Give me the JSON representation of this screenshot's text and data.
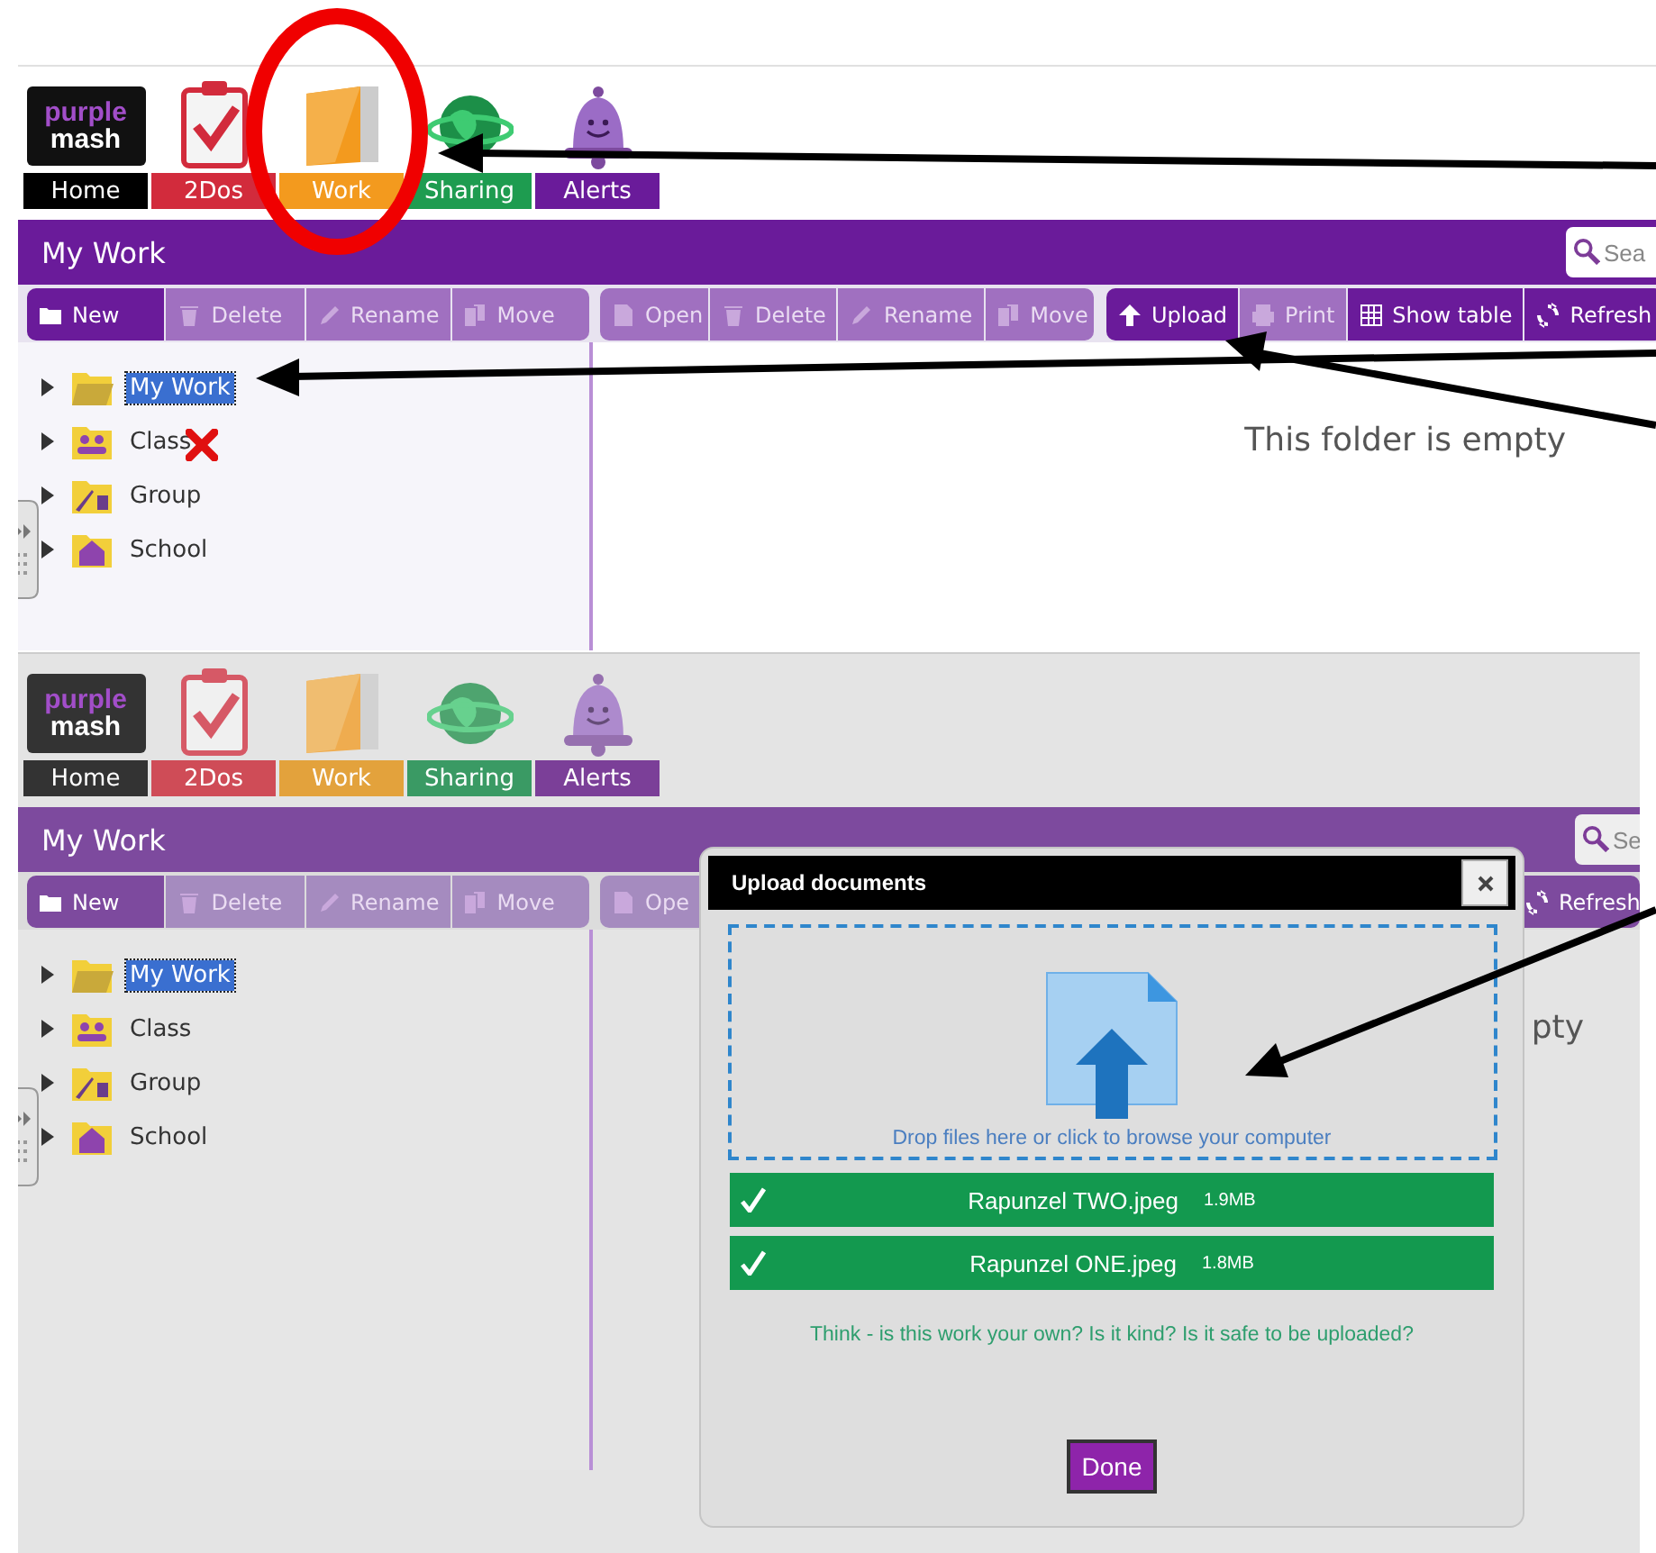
{
  "screens": [
    {
      "logo": [
        "purple",
        "mash"
      ],
      "nav": [
        {
          "label": "Home",
          "kind": "home",
          "color": "#000000"
        },
        {
          "label": "2Dos",
          "kind": "todo",
          "color": "#d22b3c"
        },
        {
          "label": "Work",
          "kind": "work",
          "color": "#f39a1e"
        },
        {
          "label": "Sharing",
          "kind": "sharing",
          "color": "#1e9c50"
        },
        {
          "label": "Alerts",
          "kind": "alerts",
          "color": "#6a1b9a"
        }
      ],
      "title": "My Work",
      "search": {
        "placeholder": "Sea"
      },
      "left_toolbar": [
        {
          "label": "New",
          "kind": "new",
          "enabled": true
        },
        {
          "label": "Delete",
          "kind": "delete",
          "enabled": false
        },
        {
          "label": "Rename",
          "kind": "rename",
          "enabled": false
        },
        {
          "label": "Move",
          "kind": "move",
          "enabled": false
        }
      ],
      "right_toolbar": [
        [
          {
            "label": "Open",
            "kind": "open",
            "enabled": false
          },
          {
            "label": "Delete",
            "kind": "delete",
            "enabled": false
          },
          {
            "label": "Rename",
            "kind": "rename",
            "enabled": false
          },
          {
            "label": "Move",
            "kind": "move",
            "enabled": false
          }
        ],
        [
          {
            "label": "Upload",
            "kind": "upload",
            "enabled": true
          },
          {
            "label": "Print",
            "kind": "print",
            "enabled": false
          },
          {
            "label": "Show table",
            "kind": "table",
            "enabled": true
          },
          {
            "label": "Refresh",
            "kind": "refresh",
            "enabled": true
          }
        ]
      ],
      "tree": [
        {
          "label": "My Work",
          "kind": "mywork",
          "selected": true,
          "expanded": false,
          "crossed": false
        },
        {
          "label": "Class",
          "kind": "class",
          "selected": false,
          "expanded": false,
          "crossed": true
        },
        {
          "label": "Group",
          "kind": "group",
          "selected": false,
          "expanded": false,
          "crossed": false
        },
        {
          "label": "School",
          "kind": "school",
          "selected": false,
          "expanded": false,
          "crossed": false
        }
      ],
      "empty_message": "This folder is empty"
    },
    {
      "logo": [
        "purple",
        "mash"
      ],
      "nav": [
        {
          "label": "Home",
          "kind": "home",
          "color": "#333333"
        },
        {
          "label": "2Dos",
          "kind": "todo",
          "color": "#cf4c57"
        },
        {
          "label": "Work",
          "kind": "work",
          "color": "#e3a23c"
        },
        {
          "label": "Sharing",
          "kind": "sharing",
          "color": "#3a9a64"
        },
        {
          "label": "Alerts",
          "kind": "alerts",
          "color": "#7b3f98"
        }
      ],
      "title": "My Work",
      "search": {
        "placeholder": "Se"
      },
      "left_toolbar": [
        {
          "label": "New",
          "kind": "new",
          "enabled": true
        },
        {
          "label": "Delete",
          "kind": "delete",
          "enabled": false
        },
        {
          "label": "Rename",
          "kind": "rename",
          "enabled": false
        },
        {
          "label": "Move",
          "kind": "move",
          "enabled": false
        }
      ],
      "right_toolbar": [
        [
          {
            "label": "Ope",
            "kind": "open",
            "enabled": false
          }
        ],
        [
          {
            "label": "Refresh",
            "kind": "refresh",
            "enabled": true
          }
        ]
      ],
      "tree": [
        {
          "label": "My Work",
          "kind": "mywork",
          "selected": true,
          "expanded": false,
          "crossed": false
        },
        {
          "label": "Class",
          "kind": "class",
          "selected": false,
          "expanded": false,
          "crossed": false
        },
        {
          "label": "Group",
          "kind": "group",
          "selected": false,
          "expanded": false,
          "crossed": false
        },
        {
          "label": "School",
          "kind": "school",
          "selected": false,
          "expanded": false,
          "crossed": false
        }
      ],
      "empty_message": "pty",
      "dialog": {
        "title": "Upload documents",
        "drop_hint": "Drop files here or click to browse your computer",
        "files": [
          {
            "name": "Rapunzel TWO.jpeg",
            "size": "1.9MB",
            "uploaded": true
          },
          {
            "name": "Rapunzel ONE.jpeg",
            "size": "1.8MB",
            "uploaded": true
          }
        ],
        "note": "Think - is this work your own? Is it kind? Is it safe to be uploaded?",
        "button": "Done"
      }
    }
  ]
}
